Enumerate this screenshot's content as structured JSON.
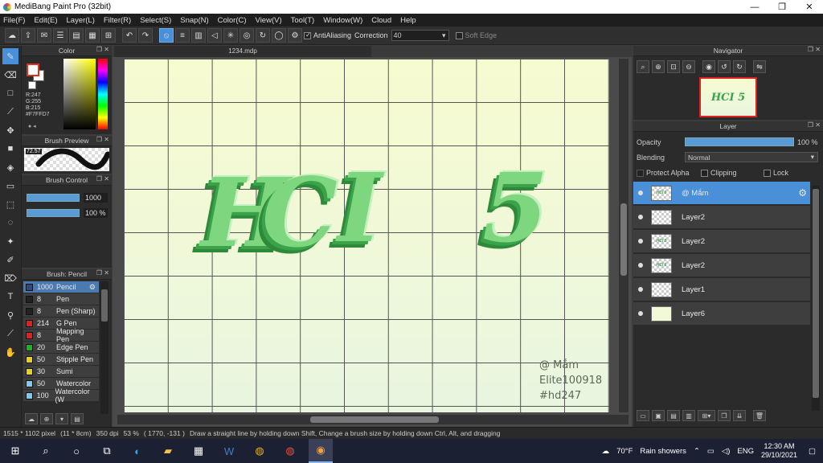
{
  "window": {
    "title": "MediBang Paint Pro (32bit)",
    "minimize_glyph": "—",
    "restore_glyph": "❐",
    "close_glyph": "✕"
  },
  "menu": [
    "File(F)",
    "Edit(E)",
    "Layer(L)",
    "Filter(R)",
    "Select(S)",
    "Snap(N)",
    "Color(C)",
    "View(V)",
    "Tool(T)",
    "Window(W)",
    "Cloud",
    "Help"
  ],
  "toolbar": {
    "antialiasing_label": "AntiAliasing",
    "antialiasing_checked": true,
    "correction_label": "Correction",
    "correction_value": "40",
    "soft_edge_label": "Soft Edge",
    "soft_edge_checked": false
  },
  "color_panel": {
    "title": "Color",
    "r": "R:247",
    "g": "G:255",
    "b": "B:215",
    "hex": "#F7FFD7",
    "fg_color": "#ffffff",
    "border_color": "#e03020"
  },
  "brush_preview": {
    "title": "Brush Preview",
    "value": "72.57"
  },
  "brush_control": {
    "title": "Brush Control",
    "size": "1000",
    "opacity": "100 %",
    "size_fraction": 1.0,
    "opacity_fraction": 1.0
  },
  "brush_list": {
    "title": "Brush: Pencil",
    "items": [
      {
        "size": "1000",
        "name": "Pencil",
        "color": "#2a4a8a",
        "selected": true
      },
      {
        "size": "8",
        "name": "Pen",
        "color": "#222222",
        "selected": false
      },
      {
        "size": "8",
        "name": "Pen (Sharp)",
        "color": "#222222",
        "selected": false
      },
      {
        "size": "214",
        "name": "G Pen",
        "color": "#e02020",
        "selected": false
      },
      {
        "size": "8",
        "name": "Mapping Pen",
        "color": "#e02020",
        "selected": false
      },
      {
        "size": "20",
        "name": "Edge Pen",
        "color": "#20b020",
        "selected": false
      },
      {
        "size": "50",
        "name": "Stipple Pen",
        "color": "#e8d020",
        "selected": false
      },
      {
        "size": "30",
        "name": "Sumi",
        "color": "#e8d020",
        "selected": false
      },
      {
        "size": "50",
        "name": "Watercolor",
        "color": "#80c8f0",
        "selected": false
      },
      {
        "size": "100",
        "name": "Watercolor (W",
        "color": "#80c8f0",
        "selected": false
      }
    ]
  },
  "document": {
    "tab_name": "1234.mdp",
    "letters": [
      "H",
      "C",
      "I",
      "5"
    ],
    "credit_lines": [
      "@ Mắm",
      "Elite100918",
      "#hd247"
    ]
  },
  "navigator": {
    "title": "Navigator",
    "thumb_text": "HCI 5"
  },
  "layer_panel": {
    "title": "Layer",
    "opacity_label": "Opacity",
    "opacity_value": "100 %",
    "blending_label": "Blending",
    "blending_value": "Normal",
    "protect_alpha_label": "Protect Alpha",
    "clipping_label": "Clipping",
    "lock_label": "Lock",
    "layers": [
      {
        "name": "@ Mắm",
        "selected": true,
        "thumb": "text"
      },
      {
        "name": "Layer2",
        "selected": false,
        "thumb": "empty"
      },
      {
        "name": "Layer2",
        "selected": false,
        "thumb": "art"
      },
      {
        "name": "Layer2",
        "selected": false,
        "thumb": "art"
      },
      {
        "name": "Layer1",
        "selected": false,
        "thumb": "empty"
      },
      {
        "name": "Layer6",
        "selected": false,
        "thumb": "solid"
      }
    ]
  },
  "statusbar": {
    "dims": "1515 * 1102 pixel",
    "size_cm": "(11 * 8cm)",
    "dpi": "350 dpi",
    "zoom": "53 %",
    "coords": "( 1770, -131 )",
    "hint": "Draw a straight line by holding down Shift, Change a brush size by holding down Ctrl, Alt, and dragging"
  },
  "taskbar": {
    "weather_temp": "70°F",
    "weather_text": "Rain showers",
    "lang": "ENG",
    "time": "12:30 AM",
    "date": "29/10/2021"
  }
}
